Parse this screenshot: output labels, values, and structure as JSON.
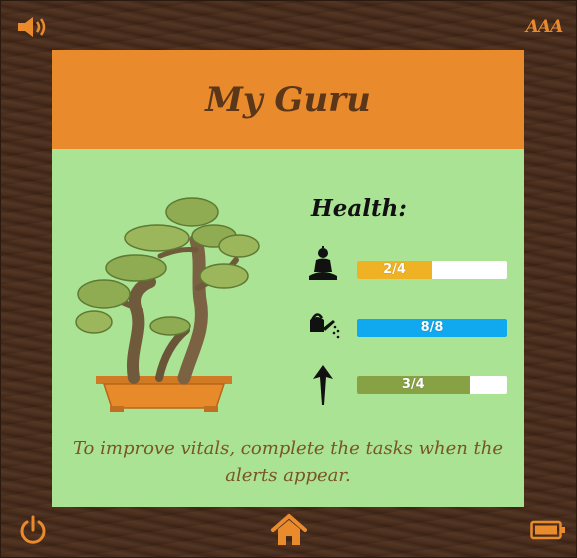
{
  "app": {
    "title": "My Guru"
  },
  "toolbar": {
    "sound_icon": "speaker-icon",
    "text_size_label": "AAA",
    "power_icon": "power-icon",
    "home_icon": "home-icon",
    "battery_icon": "battery-icon"
  },
  "health": {
    "title": "Health:",
    "stats": [
      {
        "name": "meditation",
        "icon": "meditation-icon",
        "label": "2/4",
        "fraction": 0.5,
        "color": "#f0b225"
      },
      {
        "name": "water",
        "icon": "watering-can-icon",
        "label": "8/8",
        "fraction": 1.0,
        "color": "#10a8ee"
      },
      {
        "name": "growth",
        "icon": "growth-arrow-icon",
        "label": "3/4",
        "fraction": 0.75,
        "color": "#86a244"
      }
    ]
  },
  "message": "To improve vitals, complete the tasks when the alerts appear.",
  "colors": {
    "header": "#e98b2d",
    "panel": "#a9e393",
    "title_text": "#5b3618",
    "message_text": "#7a5524"
  }
}
